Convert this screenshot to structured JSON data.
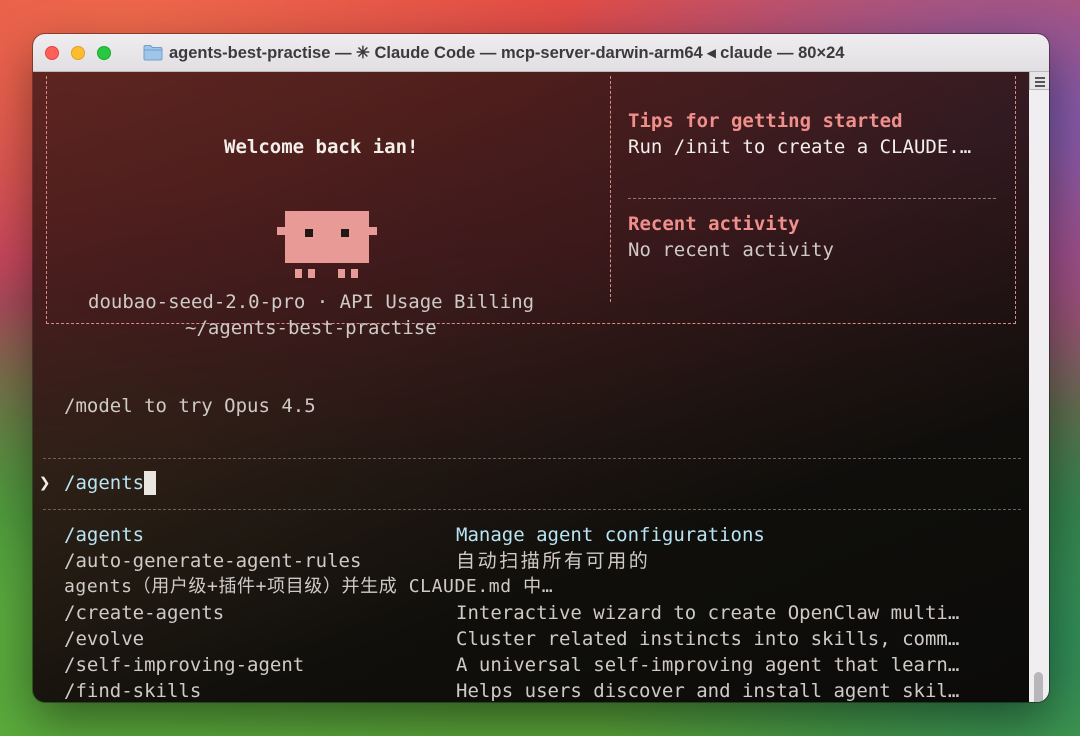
{
  "window": {
    "title": "agents-best-practise — ✳ Claude Code — mcp-server-darwin-arm64 ◂ claude — 80×24"
  },
  "welcome": {
    "greeting": "Welcome back ian!",
    "model_line": "doubao-seed-2.0-pro · API Usage Billing",
    "cwd": "~/agents-best-practise"
  },
  "tips": {
    "heading": "Tips for getting started",
    "text": "Run /init to create a CLAUDE.…"
  },
  "activity": {
    "heading": "Recent activity",
    "text": "No recent activity"
  },
  "hint": "/model to try Opus 4.5",
  "prompt": {
    "symbol": "❯",
    "input": "/agents"
  },
  "suggestions": [
    {
      "command": "/agents",
      "description": "Manage agent configurations"
    },
    {
      "command": "/auto-generate-agent-rules",
      "description": "自动扫描所有可用的"
    },
    {
      "command": "agents（用户级+插件+项目级）并生成 CLAUDE.md 中…",
      "description": ""
    },
    {
      "command": "/create-agents",
      "description": "Interactive wizard to create OpenClaw multi…"
    },
    {
      "command": "/evolve",
      "description": "Cluster related instincts into skills, comm…"
    },
    {
      "command": "/self-improving-agent",
      "description": "A universal self-improving agent that learn…"
    },
    {
      "command": "/find-skills",
      "description": "Helps users discover and install agent skil…"
    }
  ],
  "colors": {
    "accent": "#f08f8c",
    "mascot": "#e89a97",
    "highlight": "#b8e4f3"
  }
}
